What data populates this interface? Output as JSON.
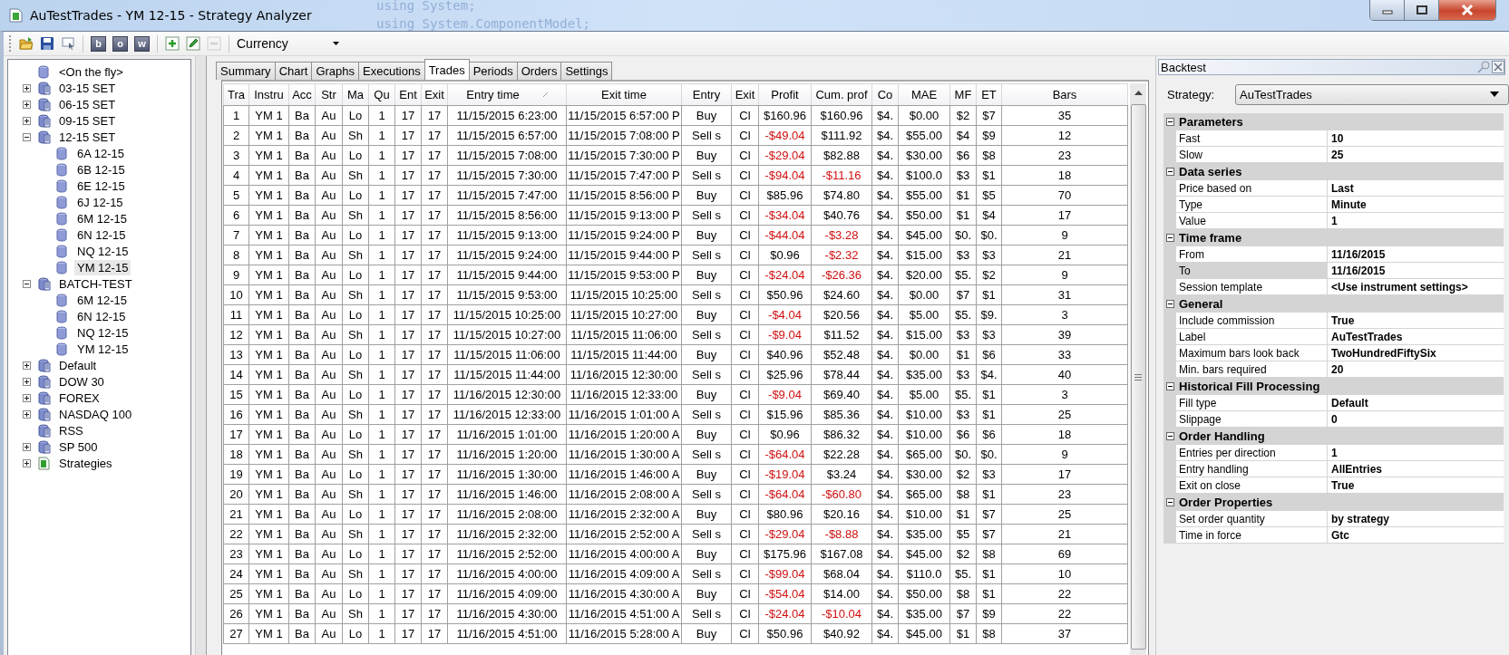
{
  "window": {
    "title": "AuTestTrades - YM 12-15 - Strategy Analyzer",
    "background_text": [
      "using System;",
      "using System.ComponentModel;"
    ]
  },
  "toolbar": {
    "buttons": [
      {
        "kind": "open",
        "disabled": false
      },
      {
        "kind": "save",
        "disabled": false
      },
      {
        "kind": "screen",
        "disabled": false
      },
      {
        "kind": "letter",
        "label": "b",
        "disabled": false
      },
      {
        "kind": "letter",
        "label": "o",
        "disabled": false
      },
      {
        "kind": "letter",
        "label": "w",
        "disabled": false
      },
      {
        "kind": "add",
        "disabled": false
      },
      {
        "kind": "edit",
        "disabled": false
      },
      {
        "kind": "remove",
        "disabled": true
      }
    ],
    "display_unit": "Currency"
  },
  "tree": [
    {
      "label": "<On the fly>",
      "kind": "instrument",
      "selected": false
    },
    {
      "label": "03-15 SET",
      "kind": "list",
      "expanded": false,
      "selected": false
    },
    {
      "label": "06-15 SET",
      "kind": "list",
      "expanded": false,
      "selected": false
    },
    {
      "label": "09-15 SET",
      "kind": "list",
      "expanded": false,
      "selected": false
    },
    {
      "label": "12-15 SET",
      "kind": "list",
      "expanded": true,
      "selected": false,
      "children": [
        {
          "label": "6A 12-15",
          "kind": "instrument",
          "selected": false
        },
        {
          "label": "6B 12-15",
          "kind": "instrument",
          "selected": false
        },
        {
          "label": "6E 12-15",
          "kind": "instrument",
          "selected": false
        },
        {
          "label": "6J 12-15",
          "kind": "instrument",
          "selected": false
        },
        {
          "label": "6M 12-15",
          "kind": "instrument",
          "selected": false
        },
        {
          "label": "6N 12-15",
          "kind": "instrument",
          "selected": false
        },
        {
          "label": "NQ 12-15",
          "kind": "instrument",
          "selected": false
        },
        {
          "label": "YM 12-15",
          "kind": "instrument",
          "selected": true
        }
      ]
    },
    {
      "label": "BATCH-TEST",
      "kind": "list",
      "expanded": true,
      "selected": false,
      "children": [
        {
          "label": "6M 12-15",
          "kind": "instrument",
          "selected": false
        },
        {
          "label": "6N 12-15",
          "kind": "instrument",
          "selected": false
        },
        {
          "label": "NQ 12-15",
          "kind": "instrument",
          "selected": false
        },
        {
          "label": "YM 12-15",
          "kind": "instrument",
          "selected": false
        }
      ]
    },
    {
      "label": "Default",
      "kind": "list",
      "expanded": false,
      "selected": false
    },
    {
      "label": "DOW 30",
      "kind": "list",
      "expanded": false,
      "selected": false
    },
    {
      "label": "FOREX",
      "kind": "list",
      "expanded": false,
      "selected": false
    },
    {
      "label": "NASDAQ 100",
      "kind": "list",
      "expanded": false,
      "selected": false
    },
    {
      "label": "RSS",
      "kind": "list",
      "selected": false
    },
    {
      "label": "SP 500",
      "kind": "list",
      "expanded": false,
      "selected": false
    },
    {
      "label": "Strategies",
      "kind": "strategies",
      "expanded": false,
      "selected": false
    }
  ],
  "tabs": [
    {
      "label": "Summary",
      "selected": false
    },
    {
      "label": "Chart",
      "selected": false
    },
    {
      "label": "Graphs",
      "selected": false
    },
    {
      "label": "Executions",
      "selected": false
    },
    {
      "label": "Trades",
      "selected": true
    },
    {
      "label": "Periods",
      "selected": false
    },
    {
      "label": "Orders",
      "selected": false
    },
    {
      "label": "Settings",
      "selected": false
    }
  ],
  "table": {
    "columns": [
      {
        "label": "Tra",
        "sorted": false
      },
      {
        "label": "Instru",
        "sorted": false
      },
      {
        "label": "Acc",
        "sorted": false
      },
      {
        "label": "Str",
        "sorted": false
      },
      {
        "label": "Ma",
        "sorted": false
      },
      {
        "label": "Qu",
        "sorted": false
      },
      {
        "label": "Ent",
        "sorted": false
      },
      {
        "label": "Exit",
        "sorted": false
      },
      {
        "label": "Entry time",
        "sorted": true
      },
      {
        "label": "Exit time",
        "sorted": false
      },
      {
        "label": "Entry",
        "sorted": false
      },
      {
        "label": "Exit",
        "sorted": false
      },
      {
        "label": "Profit",
        "sorted": false
      },
      {
        "label": "Cum. prof",
        "sorted": false
      },
      {
        "label": "Co",
        "sorted": false
      },
      {
        "label": "MAE",
        "sorted": false
      },
      {
        "label": "MF",
        "sorted": false
      },
      {
        "label": "ET",
        "sorted": false
      },
      {
        "label": "Bars",
        "sorted": false
      }
    ],
    "rows": [
      {
        "cells": [
          "1",
          "YM 1",
          "Ba",
          "Au",
          "Lo",
          "1",
          "17",
          "17",
          "11/15/2015 6:23:00",
          "11/15/2015 6:57:00 P",
          "Buy",
          "Cl",
          "$160.96",
          "$160.96",
          "$4.",
          "$0.00",
          "$2",
          "$7",
          "35"
        ],
        "profit_loss": false,
        "cum_loss": false
      },
      {
        "cells": [
          "2",
          "YM 1",
          "Ba",
          "Au",
          "Sh",
          "1",
          "17",
          "17",
          "11/15/2015 6:57:00",
          "11/15/2015 7:08:00 P",
          "Sell s",
          "Cl",
          "-$49.04",
          "$111.92",
          "$4.",
          "$55.00",
          "$4",
          "$9",
          "12"
        ],
        "profit_loss": true,
        "cum_loss": false
      },
      {
        "cells": [
          "3",
          "YM 1",
          "Ba",
          "Au",
          "Lo",
          "1",
          "17",
          "17",
          "11/15/2015 7:08:00",
          "11/15/2015 7:30:00 P",
          "Buy",
          "Cl",
          "-$29.04",
          "$82.88",
          "$4.",
          "$30.00",
          "$6",
          "$8",
          "23"
        ],
        "profit_loss": true,
        "cum_loss": false
      },
      {
        "cells": [
          "4",
          "YM 1",
          "Ba",
          "Au",
          "Sh",
          "1",
          "17",
          "17",
          "11/15/2015 7:30:00",
          "11/15/2015 7:47:00 P",
          "Sell s",
          "Cl",
          "-$94.04",
          "-$11.16",
          "$4.",
          "$100.0",
          "$3",
          "$1",
          "18"
        ],
        "profit_loss": true,
        "cum_loss": true
      },
      {
        "cells": [
          "5",
          "YM 1",
          "Ba",
          "Au",
          "Lo",
          "1",
          "17",
          "17",
          "11/15/2015 7:47:00",
          "11/15/2015 8:56:00 P",
          "Buy",
          "Cl",
          "$85.96",
          "$74.80",
          "$4.",
          "$55.00",
          "$1",
          "$5",
          "70"
        ],
        "profit_loss": false,
        "cum_loss": false
      },
      {
        "cells": [
          "6",
          "YM 1",
          "Ba",
          "Au",
          "Sh",
          "1",
          "17",
          "17",
          "11/15/2015 8:56:00",
          "11/15/2015 9:13:00 P",
          "Sell s",
          "Cl",
          "-$34.04",
          "$40.76",
          "$4.",
          "$50.00",
          "$1",
          "$4",
          "17"
        ],
        "profit_loss": true,
        "cum_loss": false
      },
      {
        "cells": [
          "7",
          "YM 1",
          "Ba",
          "Au",
          "Lo",
          "1",
          "17",
          "17",
          "11/15/2015 9:13:00",
          "11/15/2015 9:24:00 P",
          "Buy",
          "Cl",
          "-$44.04",
          "-$3.28",
          "$4.",
          "$45.00",
          "$0.",
          "$0.",
          "9"
        ],
        "profit_loss": true,
        "cum_loss": true
      },
      {
        "cells": [
          "8",
          "YM 1",
          "Ba",
          "Au",
          "Sh",
          "1",
          "17",
          "17",
          "11/15/2015 9:24:00",
          "11/15/2015 9:44:00 P",
          "Sell s",
          "Cl",
          "$0.96",
          "-$2.32",
          "$4.",
          "$15.00",
          "$3",
          "$3",
          "21"
        ],
        "profit_loss": false,
        "cum_loss": true
      },
      {
        "cells": [
          "9",
          "YM 1",
          "Ba",
          "Au",
          "Lo",
          "1",
          "17",
          "17",
          "11/15/2015 9:44:00",
          "11/15/2015 9:53:00 P",
          "Buy",
          "Cl",
          "-$24.04",
          "-$26.36",
          "$4.",
          "$20.00",
          "$5.",
          "$2",
          "9"
        ],
        "profit_loss": true,
        "cum_loss": true
      },
      {
        "cells": [
          "10",
          "YM 1",
          "Ba",
          "Au",
          "Sh",
          "1",
          "17",
          "17",
          "11/15/2015 9:53:00",
          "11/15/2015 10:25:00",
          "Sell s",
          "Cl",
          "$50.96",
          "$24.60",
          "$4.",
          "$0.00",
          "$7",
          "$1",
          "31"
        ],
        "profit_loss": false,
        "cum_loss": false
      },
      {
        "cells": [
          "11",
          "YM 1",
          "Ba",
          "Au",
          "Lo",
          "1",
          "17",
          "17",
          "11/15/2015 10:25:00",
          "11/15/2015 10:27:00",
          "Buy",
          "Cl",
          "-$4.04",
          "$20.56",
          "$4.",
          "$5.00",
          "$5.",
          "$9.",
          "3"
        ],
        "profit_loss": true,
        "cum_loss": false
      },
      {
        "cells": [
          "12",
          "YM 1",
          "Ba",
          "Au",
          "Sh",
          "1",
          "17",
          "17",
          "11/15/2015 10:27:00",
          "11/15/2015 11:06:00",
          "Sell s",
          "Cl",
          "-$9.04",
          "$11.52",
          "$4.",
          "$15.00",
          "$3",
          "$3",
          "39"
        ],
        "profit_loss": true,
        "cum_loss": false
      },
      {
        "cells": [
          "13",
          "YM 1",
          "Ba",
          "Au",
          "Lo",
          "1",
          "17",
          "17",
          "11/15/2015 11:06:00",
          "11/15/2015 11:44:00",
          "Buy",
          "Cl",
          "$40.96",
          "$52.48",
          "$4.",
          "$0.00",
          "$1",
          "$6",
          "33"
        ],
        "profit_loss": false,
        "cum_loss": false
      },
      {
        "cells": [
          "14",
          "YM 1",
          "Ba",
          "Au",
          "Sh",
          "1",
          "17",
          "17",
          "11/15/2015 11:44:00",
          "11/16/2015 12:30:00",
          "Sell s",
          "Cl",
          "$25.96",
          "$78.44",
          "$4.",
          "$35.00",
          "$3",
          "$4.",
          "40"
        ],
        "profit_loss": false,
        "cum_loss": false
      },
      {
        "cells": [
          "15",
          "YM 1",
          "Ba",
          "Au",
          "Lo",
          "1",
          "17",
          "17",
          "11/16/2015 12:30:00",
          "11/16/2015 12:33:00",
          "Buy",
          "Cl",
          "-$9.04",
          "$69.40",
          "$4.",
          "$5.00",
          "$5.",
          "$1",
          "3"
        ],
        "profit_loss": true,
        "cum_loss": false
      },
      {
        "cells": [
          "16",
          "YM 1",
          "Ba",
          "Au",
          "Sh",
          "1",
          "17",
          "17",
          "11/16/2015 12:33:00",
          "11/16/2015 1:01:00 A",
          "Sell s",
          "Cl",
          "$15.96",
          "$85.36",
          "$4.",
          "$10.00",
          "$3",
          "$1",
          "25"
        ],
        "profit_loss": false,
        "cum_loss": false
      },
      {
        "cells": [
          "17",
          "YM 1",
          "Ba",
          "Au",
          "Lo",
          "1",
          "17",
          "17",
          "11/16/2015 1:01:00",
          "11/16/2015 1:20:00 A",
          "Buy",
          "Cl",
          "$0.96",
          "$86.32",
          "$4.",
          "$10.00",
          "$6",
          "$6",
          "18"
        ],
        "profit_loss": false,
        "cum_loss": false
      },
      {
        "cells": [
          "18",
          "YM 1",
          "Ba",
          "Au",
          "Sh",
          "1",
          "17",
          "17",
          "11/16/2015 1:20:00",
          "11/16/2015 1:30:00 A",
          "Sell s",
          "Cl",
          "-$64.04",
          "$22.28",
          "$4.",
          "$65.00",
          "$0.",
          "$0.",
          "9"
        ],
        "profit_loss": true,
        "cum_loss": false
      },
      {
        "cells": [
          "19",
          "YM 1",
          "Ba",
          "Au",
          "Lo",
          "1",
          "17",
          "17",
          "11/16/2015 1:30:00",
          "11/16/2015 1:46:00 A",
          "Buy",
          "Cl",
          "-$19.04",
          "$3.24",
          "$4.",
          "$30.00",
          "$2",
          "$3",
          "17"
        ],
        "profit_loss": true,
        "cum_loss": false
      },
      {
        "cells": [
          "20",
          "YM 1",
          "Ba",
          "Au",
          "Sh",
          "1",
          "17",
          "17",
          "11/16/2015 1:46:00",
          "11/16/2015 2:08:00 A",
          "Sell s",
          "Cl",
          "-$64.04",
          "-$60.80",
          "$4.",
          "$65.00",
          "$8",
          "$1",
          "23"
        ],
        "profit_loss": true,
        "cum_loss": true
      },
      {
        "cells": [
          "21",
          "YM 1",
          "Ba",
          "Au",
          "Lo",
          "1",
          "17",
          "17",
          "11/16/2015 2:08:00",
          "11/16/2015 2:32:00 A",
          "Buy",
          "Cl",
          "$80.96",
          "$20.16",
          "$4.",
          "$10.00",
          "$1",
          "$7",
          "25"
        ],
        "profit_loss": false,
        "cum_loss": false
      },
      {
        "cells": [
          "22",
          "YM 1",
          "Ba",
          "Au",
          "Sh",
          "1",
          "17",
          "17",
          "11/16/2015 2:32:00",
          "11/16/2015 2:52:00 A",
          "Sell s",
          "Cl",
          "-$29.04",
          "-$8.88",
          "$4.",
          "$35.00",
          "$5",
          "$7",
          "21"
        ],
        "profit_loss": true,
        "cum_loss": true
      },
      {
        "cells": [
          "23",
          "YM 1",
          "Ba",
          "Au",
          "Lo",
          "1",
          "17",
          "17",
          "11/16/2015 2:52:00",
          "11/16/2015 4:00:00 A",
          "Buy",
          "Cl",
          "$175.96",
          "$167.08",
          "$4.",
          "$45.00",
          "$2",
          "$8",
          "69"
        ],
        "profit_loss": false,
        "cum_loss": false
      },
      {
        "cells": [
          "24",
          "YM 1",
          "Ba",
          "Au",
          "Sh",
          "1",
          "17",
          "17",
          "11/16/2015 4:00:00",
          "11/16/2015 4:09:00 A",
          "Sell s",
          "Cl",
          "-$99.04",
          "$68.04",
          "$4.",
          "$110.0",
          "$5.",
          "$1",
          "10"
        ],
        "profit_loss": true,
        "cum_loss": false
      },
      {
        "cells": [
          "25",
          "YM 1",
          "Ba",
          "Au",
          "Lo",
          "1",
          "17",
          "17",
          "11/16/2015 4:09:00",
          "11/16/2015 4:30:00 A",
          "Buy",
          "Cl",
          "-$54.04",
          "$14.00",
          "$4.",
          "$50.00",
          "$8",
          "$1",
          "22"
        ],
        "profit_loss": true,
        "cum_loss": false
      },
      {
        "cells": [
          "26",
          "YM 1",
          "Ba",
          "Au",
          "Sh",
          "1",
          "17",
          "17",
          "11/16/2015 4:30:00",
          "11/16/2015 4:51:00 A",
          "Sell s",
          "Cl",
          "-$24.04",
          "-$10.04",
          "$4.",
          "$35.00",
          "$7",
          "$9",
          "22"
        ],
        "profit_loss": true,
        "cum_loss": true
      },
      {
        "cells": [
          "27",
          "YM 1",
          "Ba",
          "Au",
          "Lo",
          "1",
          "17",
          "17",
          "11/16/2015 4:51:00",
          "11/16/2015 5:28:00 A",
          "Buy",
          "Cl",
          "$50.96",
          "$40.92",
          "$4.",
          "$45.00",
          "$1",
          "$8",
          "37"
        ],
        "profit_loss": false,
        "cum_loss": false
      }
    ]
  },
  "backtest": {
    "title": "Backtest",
    "strategy_label": "Strategy:",
    "strategy": "AuTestTrades",
    "sections": [
      {
        "title": "Parameters",
        "expanded": true,
        "properties": [
          {
            "name": "Fast",
            "value": "10",
            "selected": false
          },
          {
            "name": "Slow",
            "value": "25",
            "selected": false
          }
        ]
      },
      {
        "title": "Data series",
        "expanded": true,
        "properties": [
          {
            "name": "Price based on",
            "value": "Last",
            "selected": false
          },
          {
            "name": "Type",
            "value": "Minute",
            "selected": false
          },
          {
            "name": "Value",
            "value": "1",
            "selected": false
          }
        ]
      },
      {
        "title": "Time frame",
        "expanded": true,
        "properties": [
          {
            "name": "From",
            "value": "11/16/2015",
            "selected": false
          },
          {
            "name": "To",
            "value": "11/16/2015",
            "selected": true
          },
          {
            "name": "Session template",
            "value": "<Use instrument settings>",
            "selected": false
          }
        ]
      },
      {
        "title": "General",
        "expanded": true,
        "properties": [
          {
            "name": "Include commission",
            "value": "True",
            "selected": false
          },
          {
            "name": "Label",
            "value": "AuTestTrades",
            "selected": false
          },
          {
            "name": "Maximum bars look back",
            "value": "TwoHundredFiftySix",
            "selected": false
          },
          {
            "name": "Min. bars required",
            "value": "20",
            "selected": false
          }
        ]
      },
      {
        "title": "Historical Fill Processing",
        "expanded": true,
        "properties": [
          {
            "name": "Fill type",
            "value": "Default",
            "selected": false
          },
          {
            "name": "Slippage",
            "value": "0",
            "selected": false
          }
        ]
      },
      {
        "title": "Order Handling",
        "expanded": true,
        "properties": [
          {
            "name": "Entries per direction",
            "value": "1",
            "selected": false
          },
          {
            "name": "Entry handling",
            "value": "AllEntries",
            "selected": false
          },
          {
            "name": "Exit on close",
            "value": "True",
            "selected": false
          }
        ]
      },
      {
        "title": "Order Properties",
        "expanded": true,
        "properties": [
          {
            "name": "Set order quantity",
            "value": "by strategy",
            "selected": false
          },
          {
            "name": "Time in force",
            "value": "Gtc",
            "selected": false
          }
        ]
      }
    ]
  }
}
